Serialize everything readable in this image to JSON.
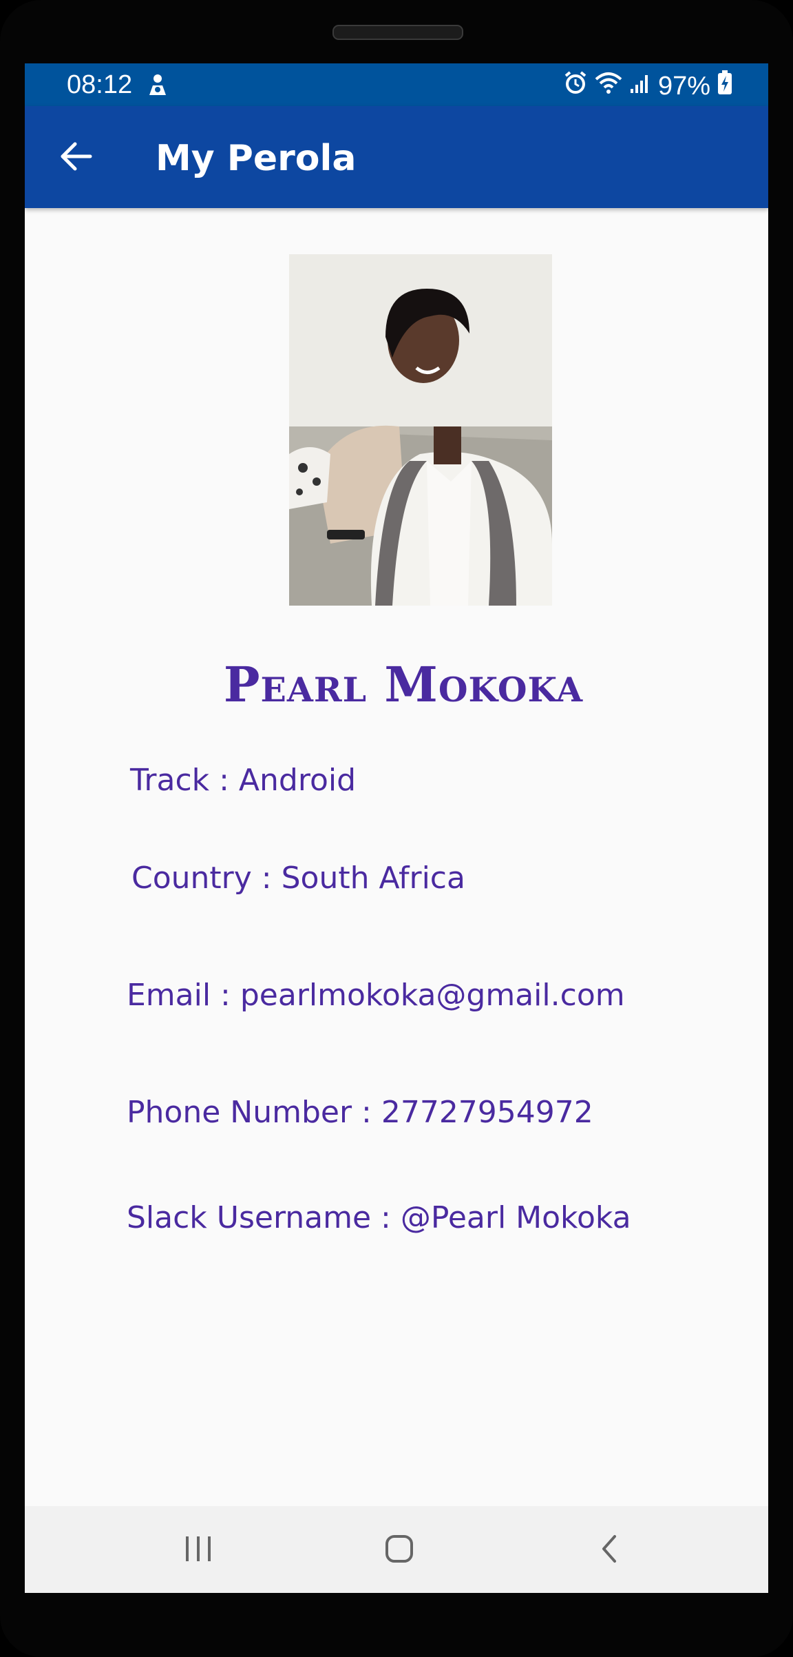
{
  "status_bar": {
    "time": "08:12",
    "battery": "97%"
  },
  "app_bar": {
    "title": "My Perola"
  },
  "profile": {
    "name": "Pearl Mokoka",
    "track": "Track : Android",
    "country": "Country : South Africa",
    "email": "Email : pearlmokoka@gmail.com",
    "phone": "Phone Number : 27727954972",
    "slack": "Slack Username : @Pearl Mokoka"
  },
  "colors": {
    "status_bar": "#00539c",
    "app_bar": "#0d47a1",
    "text_accent": "#4a2aa0",
    "background": "#fafafa"
  },
  "icons": {
    "back": "arrow-left-icon",
    "status": [
      "person-icon",
      "alarm-icon",
      "wifi-icon",
      "signal-icon",
      "battery-charging-icon"
    ],
    "nav": [
      "recent-apps-icon",
      "home-icon",
      "back-chevron-icon"
    ]
  }
}
